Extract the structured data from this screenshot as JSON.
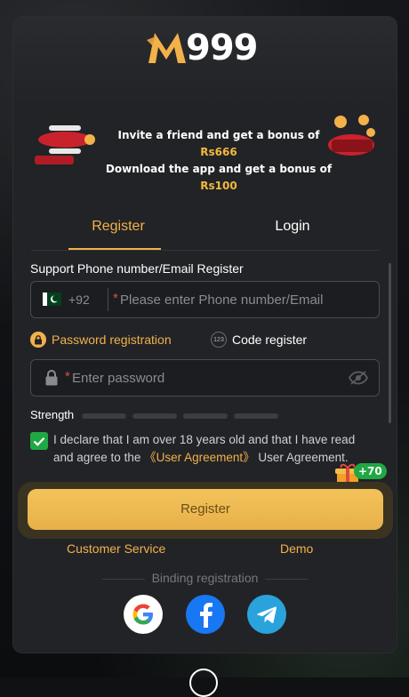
{
  "brand": {
    "logo_text": "999",
    "accent": "#f3b14a"
  },
  "banner": {
    "line1_prefix": "Invite a friend and get a bonus of ",
    "line1_amount": "Rs666",
    "line2_prefix": "Download the app and get a bonus of ",
    "line2_amount": "Rs100"
  },
  "tabs": [
    {
      "label": "Register",
      "active": true
    },
    {
      "label": "Login",
      "active": false
    }
  ],
  "form": {
    "section_label": "Support Phone number/Email Register",
    "country_code": "+92",
    "phone_placeholder": "Please enter Phone number/Email",
    "password_placeholder": "Enter password",
    "option_password": "Password registration",
    "option_code": "Code register",
    "option_code_icon_text": "123",
    "strength_label": "Strength",
    "agreement_text_1": "I declare that I am over 18 years old and that I have read and agree to the ",
    "agreement_link": "《User Agreement》",
    "agreement_text_2": " User Agreement.",
    "agreement_checked": true,
    "bonus_badge": "+70",
    "register_button": "Register"
  },
  "links": {
    "customer_service": "Customer Service",
    "demo": "Demo"
  },
  "binding": {
    "label": "Binding registration",
    "providers": [
      "google-icon",
      "facebook-icon",
      "telegram-icon"
    ]
  }
}
